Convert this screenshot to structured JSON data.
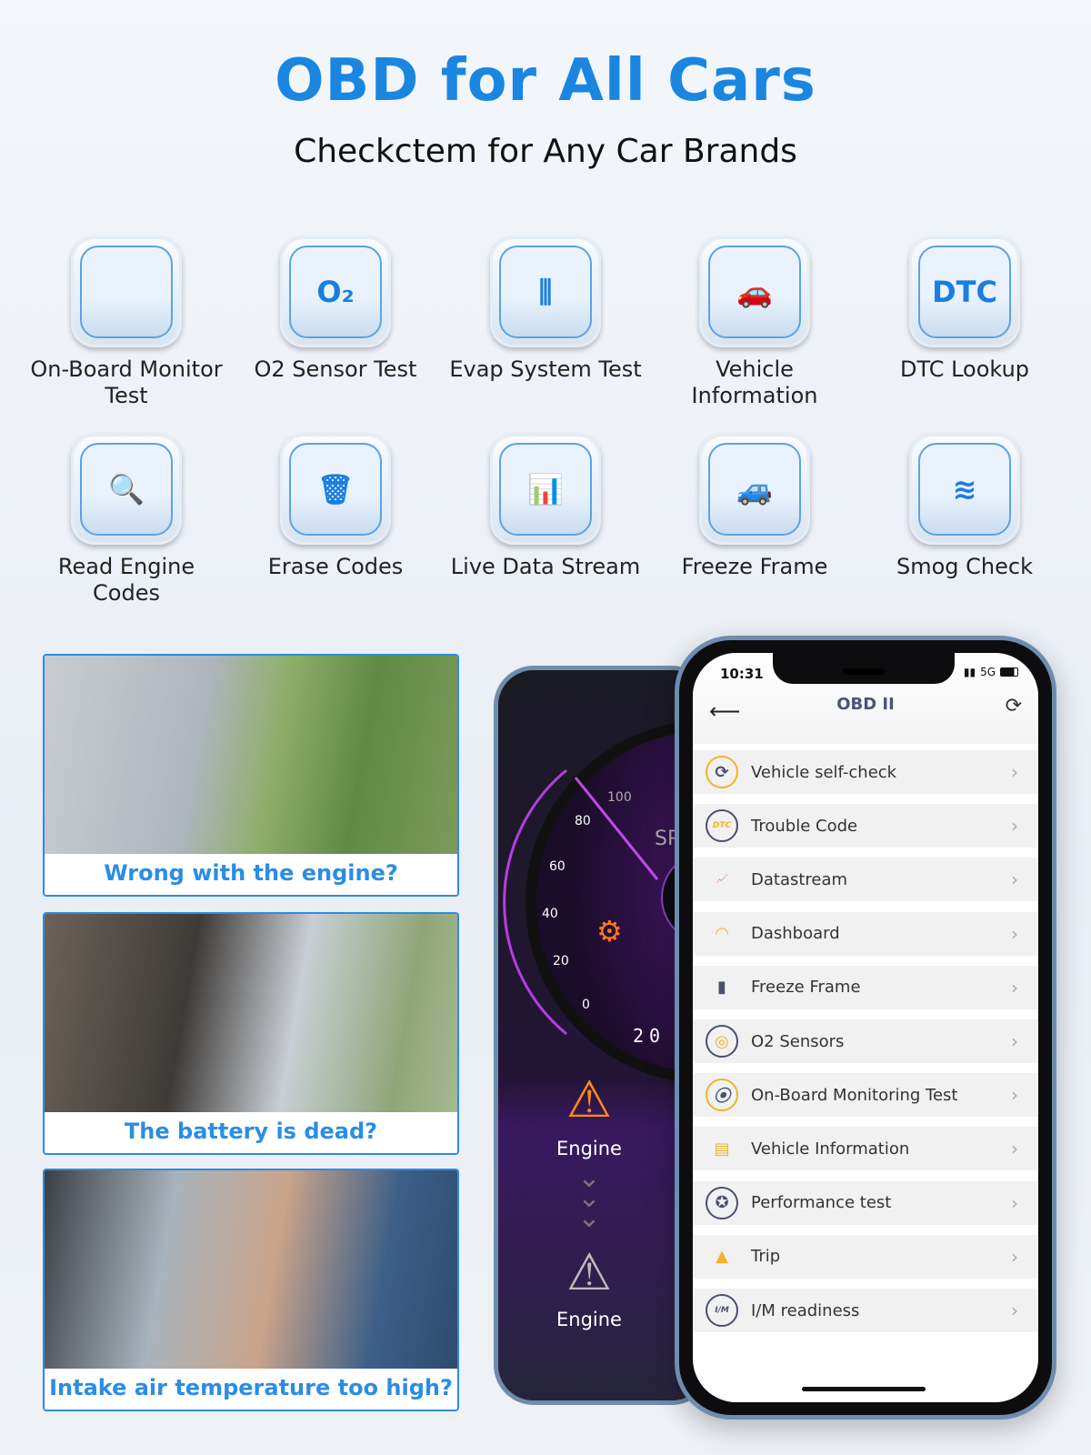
{
  "header": {
    "title": "OBD for All Cars",
    "subtitle": "Checkctem for Any Car Brands"
  },
  "features": [
    {
      "label": "On-Board Monitor Test",
      "icon": "code-document-gear-icon"
    },
    {
      "label": "O2 Sensor Test",
      "icon": "o2-sensor-icon"
    },
    {
      "label": "Evap System Test",
      "icon": "evap-canister-icon"
    },
    {
      "label": "Vehicle Information",
      "icon": "clipboard-car-icon"
    },
    {
      "label": "DTC Lookup",
      "icon": "dtc-search-icon"
    },
    {
      "label": "Read Engine Codes",
      "icon": "car-magnifier-icon"
    },
    {
      "label": "Erase Codes",
      "icon": "car-trash-icon"
    },
    {
      "label": "Live Data Stream",
      "icon": "chart-eye-icon"
    },
    {
      "label": "Freeze Frame",
      "icon": "car-chart-icon"
    },
    {
      "label": "Smog Check",
      "icon": "heat-waves-icon"
    }
  ],
  "cards": [
    {
      "caption": "Wrong with the engine?"
    },
    {
      "caption": "The battery is dead?"
    },
    {
      "caption": "Intake air temperature too high?"
    }
  ],
  "back_phone": {
    "gauge_ticks": [
      "0",
      "20",
      "40",
      "60",
      "80",
      "100"
    ],
    "engine_label_1": "Engine",
    "engine_label_2": "Engine",
    "odometer": "20"
  },
  "phone": {
    "time": "10:31",
    "network": "5G",
    "title": "OBD II",
    "menu": [
      {
        "label": "Vehicle self-check",
        "icon": "car-rotate-icon"
      },
      {
        "label": "Trouble Code",
        "icon": "dtc-icon"
      },
      {
        "label": "Datastream",
        "icon": "bar-trend-icon"
      },
      {
        "label": "Dashboard",
        "icon": "gauge-icon"
      },
      {
        "label": "Freeze Frame",
        "icon": "bar-lock-icon"
      },
      {
        "label": "O2 Sensors",
        "icon": "o2-icon"
      },
      {
        "label": "On-Board Monitoring Test",
        "icon": "monitor-pin-icon"
      },
      {
        "label": "Vehicle Information",
        "icon": "car-card-icon"
      },
      {
        "label": "Performance test",
        "icon": "speed-test-icon"
      },
      {
        "label": "Trip",
        "icon": "road-icon"
      },
      {
        "label": "I/M readiness",
        "icon": "im-icon"
      }
    ]
  },
  "colors": {
    "accent": "#1a86e0",
    "menu_icon_yellow": "#f0b429",
    "menu_icon_navy": "#4a4f6e"
  }
}
